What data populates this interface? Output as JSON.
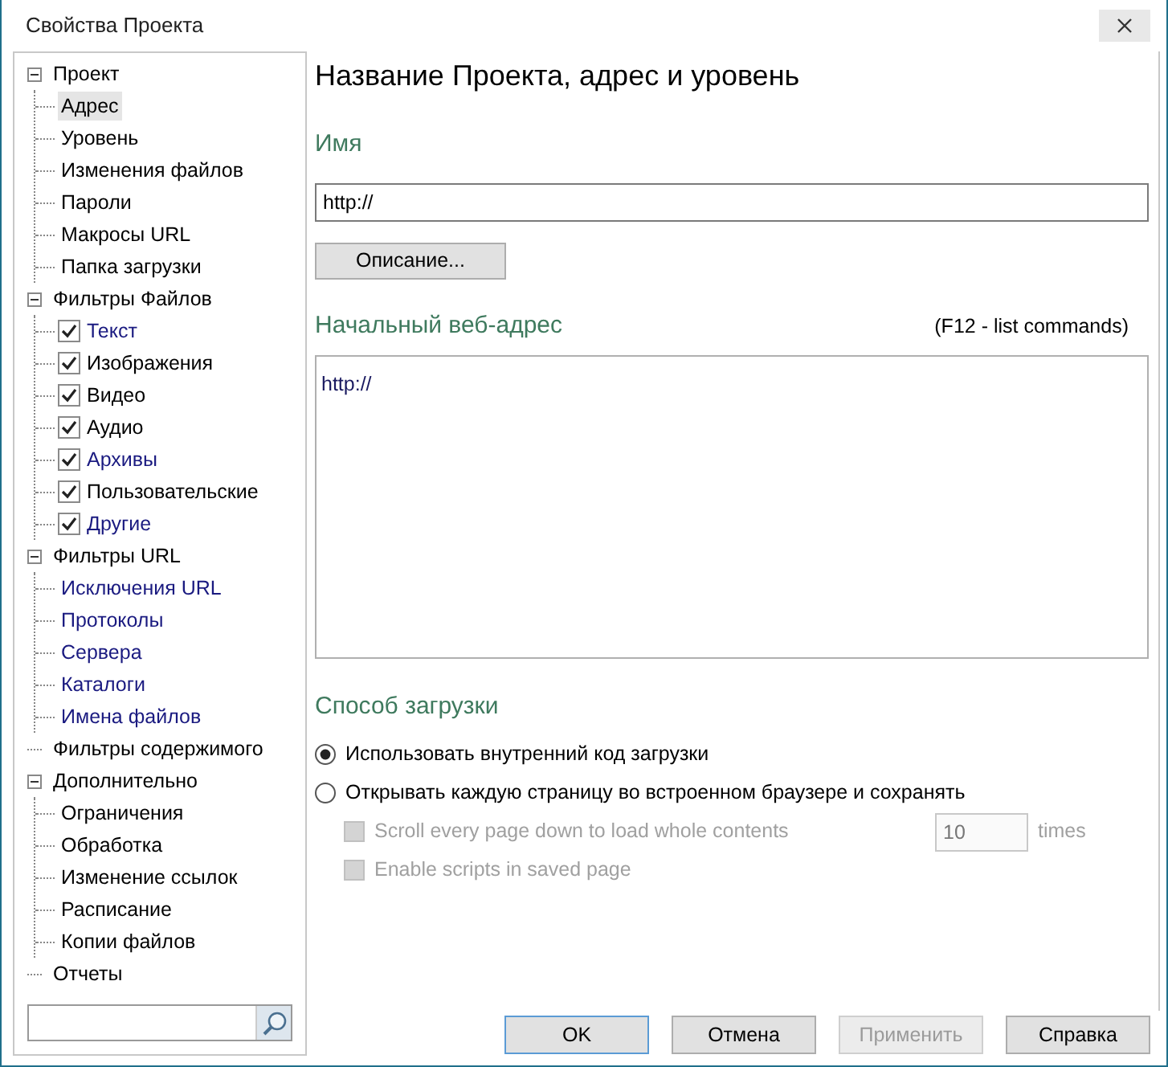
{
  "window": {
    "title": "Свойства Проекта"
  },
  "tree": [
    {
      "label": "Проект",
      "expanded": true,
      "selected": false,
      "children": [
        {
          "label": "Адрес",
          "kind": "plain",
          "selected": true,
          "active": false
        },
        {
          "label": "Уровень",
          "kind": "plain",
          "selected": false,
          "active": false
        },
        {
          "label": "Изменения файлов",
          "kind": "plain",
          "selected": false,
          "active": false
        },
        {
          "label": "Пароли",
          "kind": "plain",
          "selected": false,
          "active": false
        },
        {
          "label": "Макросы URL",
          "kind": "plain",
          "selected": false,
          "active": false
        },
        {
          "label": "Папка загрузки",
          "kind": "plain",
          "selected": false,
          "active": false
        }
      ]
    },
    {
      "label": "Фильтры Файлов",
      "expanded": true,
      "selected": false,
      "children": [
        {
          "label": "Текст",
          "kind": "checkbox",
          "checked": true,
          "selected": false,
          "active": true
        },
        {
          "label": "Изображения",
          "kind": "checkbox",
          "checked": true,
          "selected": false,
          "active": false
        },
        {
          "label": "Видео",
          "kind": "checkbox",
          "checked": true,
          "selected": false,
          "active": false
        },
        {
          "label": "Аудио",
          "kind": "checkbox",
          "checked": true,
          "selected": false,
          "active": false
        },
        {
          "label": "Архивы",
          "kind": "checkbox",
          "checked": true,
          "selected": false,
          "active": true
        },
        {
          "label": "Пользовательские",
          "kind": "checkbox",
          "checked": true,
          "selected": false,
          "active": false
        },
        {
          "label": "Другие",
          "kind": "checkbox",
          "checked": true,
          "selected": false,
          "active": true
        }
      ]
    },
    {
      "label": "Фильтры URL",
      "expanded": true,
      "selected": false,
      "children": [
        {
          "label": "Исключения URL",
          "kind": "plain",
          "selected": false,
          "active": true
        },
        {
          "label": "Протоколы",
          "kind": "plain",
          "selected": false,
          "active": true
        },
        {
          "label": "Сервера",
          "kind": "plain",
          "selected": false,
          "active": true
        },
        {
          "label": "Каталоги",
          "kind": "plain",
          "selected": false,
          "active": true
        },
        {
          "label": "Имена файлов",
          "kind": "plain",
          "selected": false,
          "active": true
        }
      ]
    },
    {
      "label": "Фильтры содержимого",
      "selected": false
    },
    {
      "label": "Дополнительно",
      "expanded": true,
      "selected": false,
      "children": [
        {
          "label": "Ограничения",
          "kind": "plain",
          "selected": false,
          "active": false
        },
        {
          "label": "Обработка",
          "kind": "plain",
          "selected": false,
          "active": false
        },
        {
          "label": "Изменение ссылок",
          "kind": "plain",
          "selected": false,
          "active": false
        },
        {
          "label": "Расписание",
          "kind": "plain",
          "selected": false,
          "active": false
        },
        {
          "label": "Копии файлов",
          "kind": "plain",
          "selected": false,
          "active": false
        }
      ]
    },
    {
      "label": "Отчеты",
      "selected": false
    }
  ],
  "page": {
    "title": "Название Проекта, адрес и уровень",
    "name_label": "Имя",
    "name_value": "http://",
    "description_button": "Описание...",
    "url_label": "Начальный веб-адрес",
    "url_hint": "(F12 - list commands)",
    "url_value": "http://",
    "mode_label": "Способ загрузки",
    "modes": [
      {
        "label": "Использовать внутренний код загрузки",
        "selected": true
      },
      {
        "label": "Открывать каждую страницу во встроенном браузере и сохранять",
        "selected": false
      }
    ],
    "options": [
      {
        "label": "Scroll every page down to load whole contents",
        "checked": false,
        "disabled": true,
        "count": "10",
        "unit": "times"
      },
      {
        "label": "Enable scripts in saved page",
        "checked": false,
        "disabled": true
      }
    ]
  },
  "buttons": [
    {
      "label": "OK",
      "disabled": false,
      "default": true
    },
    {
      "label": "Отмена",
      "disabled": false,
      "default": false
    },
    {
      "label": "Применить",
      "disabled": true,
      "default": false
    },
    {
      "label": "Справка",
      "disabled": false,
      "default": false
    }
  ]
}
